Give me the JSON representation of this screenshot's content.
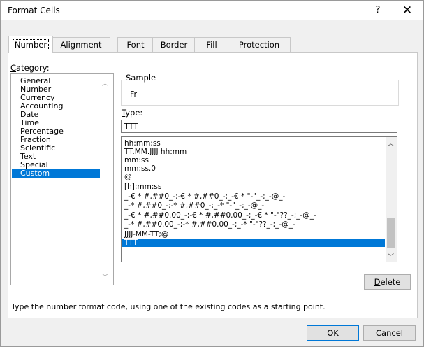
{
  "dialog": {
    "title": "Format Cells",
    "help": "?",
    "close": "✕"
  },
  "tabs": [
    "Number",
    "Alignment",
    "Font",
    "Border",
    "Fill",
    "Protection"
  ],
  "active_tab": "Number",
  "category": {
    "label_underlined": "C",
    "label_rest": "ategory:",
    "items": [
      "General",
      "Number",
      "Currency",
      "Accounting",
      "Date",
      "Time",
      "Percentage",
      "Fraction",
      "Scientific",
      "Text",
      "Special",
      "Custom"
    ],
    "selected": "Custom"
  },
  "sample": {
    "label": "Sample",
    "value": "Fr"
  },
  "type": {
    "label_underlined": "T",
    "label_rest": "ype:",
    "value": "TTT",
    "formats": [
      "hh:mm:ss",
      "TT.MM.JJJJ hh:mm",
      "mm:ss",
      "mm:ss.0",
      "@",
      "[h]:mm:ss",
      "_-€ * #,##0_-;-€ * #,##0_-;_-€ * \"-\"_-;_-@_-",
      "_-* #,##0_-;-* #,##0_-;_-* \"-\"_-;_-@_-",
      "_-€ * #,##0.00_-;-€ * #,##0.00_-;_-€ * \"-\"??_-;_-@_-",
      "_-* #,##0.00_-;-* #,##0.00_-;_-* \"-\"??_-;_-@_-",
      "JJJJ-MM-TT;@",
      "TTT"
    ],
    "selected": "TTT"
  },
  "buttons": {
    "delete_underlined": "D",
    "delete_rest": "elete",
    "ok": "OK",
    "cancel": "Cancel"
  },
  "hint": "Type the number format code, using one of the existing codes as a starting point.",
  "colors": {
    "selection": "#0078d7",
    "dialog_bg": "#f0f0f0",
    "panel_bg": "#ffffff"
  }
}
